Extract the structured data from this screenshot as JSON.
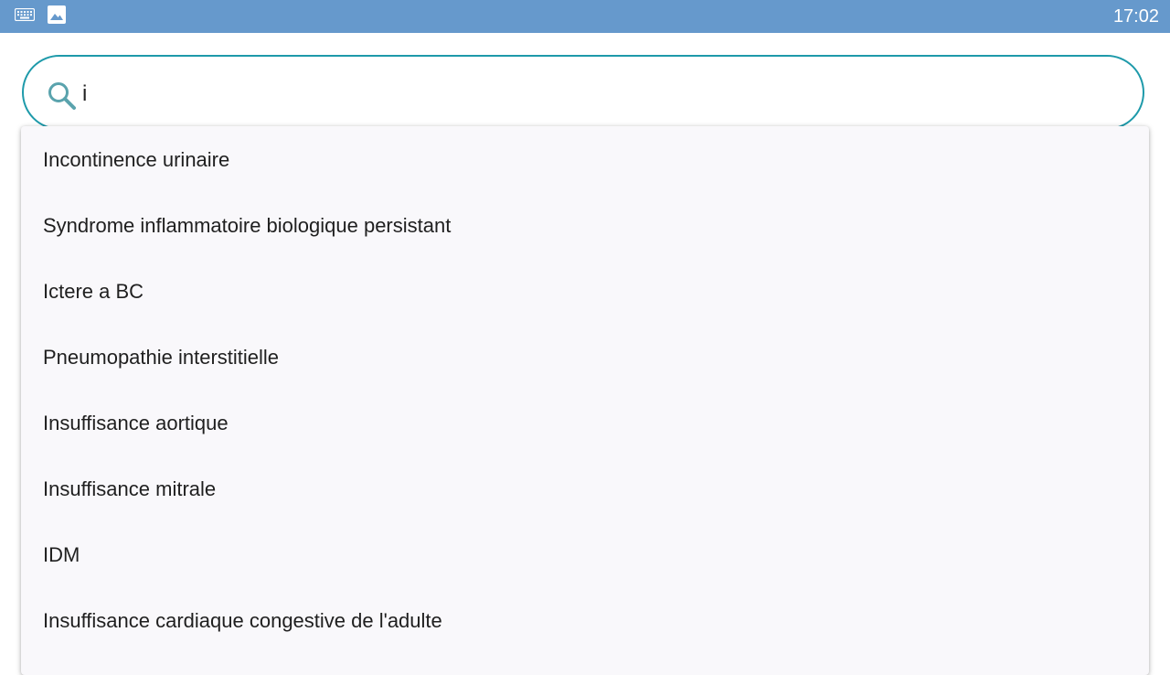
{
  "status_bar": {
    "time": "17:02",
    "icons": [
      "keyboard-icon",
      "image-icon"
    ],
    "color": "#6699cc"
  },
  "search": {
    "value": "i",
    "icon": "search-icon",
    "accent_color": "#1e9aaa"
  },
  "suggestions": [
    {
      "label": "Incontinence urinaire"
    },
    {
      "label": "Syndrome inflammatoire biologique persistant"
    },
    {
      "label": "Ictere a BC"
    },
    {
      "label": "Pneumopathie interstitielle"
    },
    {
      "label": "Insuffisance aortique"
    },
    {
      "label": "Insuffisance mitrale"
    },
    {
      "label": "IDM"
    },
    {
      "label": "Insuffisance cardiaque congestive de l'adulte"
    }
  ]
}
